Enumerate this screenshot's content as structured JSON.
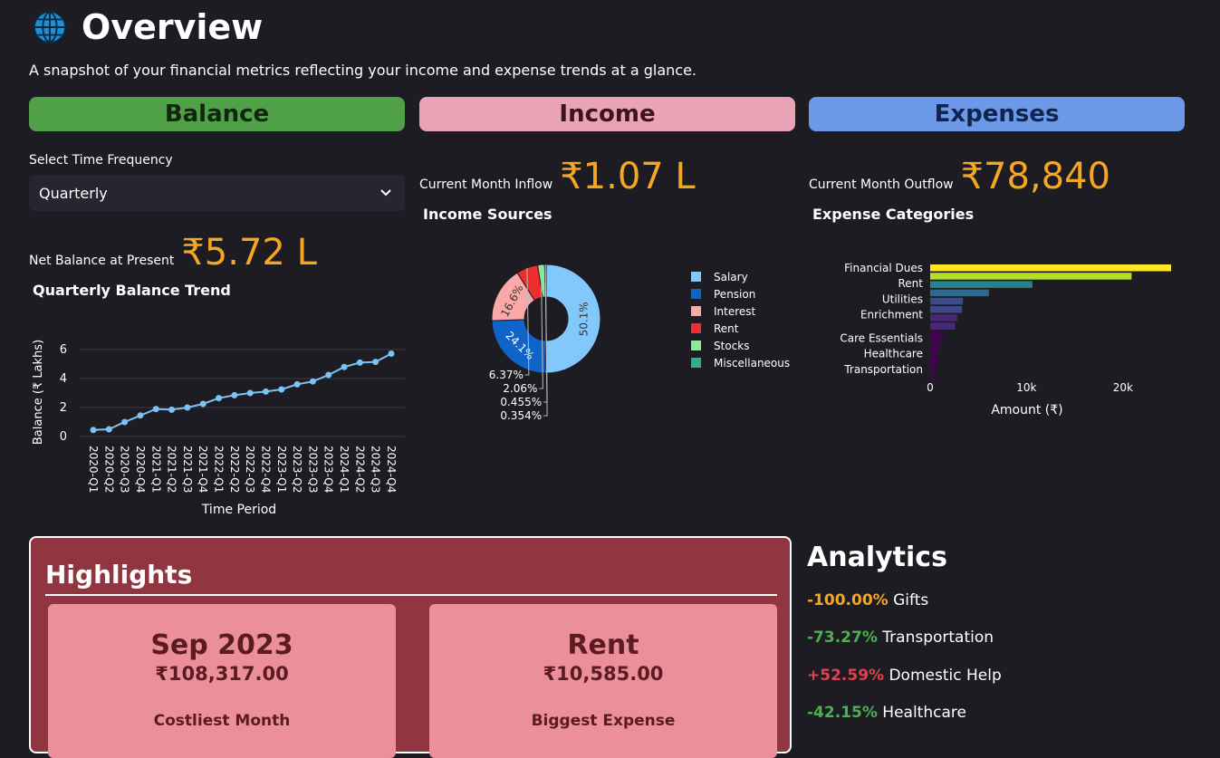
{
  "header": {
    "title": "Overview",
    "subtitle": "A snapshot of your financial metrics reflecting your income and expense trends at a glance.",
    "icon": "globe-icon"
  },
  "sections": {
    "balance": "Balance",
    "income": "Income",
    "expenses": "Expenses"
  },
  "colors": {
    "balance": "#4fa047",
    "income": "#e9a2b6",
    "expenses": "#6b99e8",
    "accent_value": "#f5a623",
    "highlights_bg": "#8f3640",
    "card_bg": "#eb9098",
    "positive": "#4caf50",
    "negative": "#e0414f"
  },
  "balance": {
    "frequency_label": "Select Time Frequency",
    "frequency_value": "Quarterly",
    "net_label": "Net Balance at Present",
    "net_value": "₹5.72 L",
    "chart_title": "Quarterly Balance Trend"
  },
  "income": {
    "inflow_label": "Current Month Inflow",
    "inflow_value": "₹1.07 L",
    "chart_title": "Income Sources"
  },
  "expenses": {
    "outflow_label": "Current Month Outflow",
    "outflow_value": "₹78,840",
    "chart_title": "Expense Categories"
  },
  "chart_data": [
    {
      "type": "line",
      "title": "Quarterly Balance Trend",
      "xlabel": "Time Period",
      "ylabel": "Balance (₹ Lakhs)",
      "x": [
        "2020-Q1",
        "2020-Q2",
        "2020-Q3",
        "2020-Q4",
        "2021-Q1",
        "2021-Q2",
        "2021-Q3",
        "2021-Q4",
        "2022-Q1",
        "2022-Q2",
        "2022-Q3",
        "2022-Q4",
        "2023-Q1",
        "2023-Q2",
        "2023-Q3",
        "2023-Q4",
        "2024-Q1",
        "2024-Q2",
        "2024-Q3",
        "2024-Q4"
      ],
      "y": [
        0.45,
        0.5,
        1.0,
        1.45,
        1.9,
        1.85,
        2.0,
        2.25,
        2.65,
        2.85,
        3.0,
        3.1,
        3.25,
        3.6,
        3.8,
        4.25,
        4.8,
        5.1,
        5.15,
        5.72
      ],
      "ylim": [
        -0.5,
        7
      ],
      "yticks": [
        0,
        2,
        4,
        6
      ],
      "color": "#7cc3f5",
      "grid": true
    },
    {
      "type": "pie",
      "title": "Income Sources",
      "labels": [
        "Salary",
        "Pension",
        "Interest",
        "Rent",
        "Stocks",
        "Miscellaneous"
      ],
      "values": [
        50.1,
        24.1,
        16.6,
        6.37,
        2.06,
        0.455
      ],
      "display_labels": [
        "50.1%",
        "24.1%",
        "16.6%",
        "6.37%",
        "2.06%",
        "0.455%"
      ],
      "extra_label": "0.354%",
      "colors": [
        "#82c8fb",
        "#0f64c8",
        "#fba8a8",
        "#ef2f2f",
        "#8de99b",
        "#2ab08f"
      ],
      "legend": "right"
    },
    {
      "type": "bar",
      "orientation": "horizontal",
      "title": "Expense Categories",
      "xlabel": "Amount (₹)",
      "tick_labels": [
        "Financial Dues",
        "Rent",
        "Utilities",
        "Enrichment",
        "Care Essentials",
        "Healthcare",
        "Transportation"
      ],
      "categories": [
        "Financial Dues",
        "",
        "Rent",
        "",
        "Utilities",
        "",
        "",
        "Enrichment",
        "",
        "Care Essentials",
        "",
        "Healthcare",
        "",
        "Transportation"
      ],
      "values": [
        25000,
        20900,
        10600,
        6100,
        3400,
        3300,
        2800,
        2600,
        1400,
        1100,
        900,
        800,
        700,
        450
      ],
      "colors": [
        "#fde725",
        "#b5de2b",
        "#26828e",
        "#31688e",
        "#3e4989",
        "#3e4989",
        "#482878",
        "#482878",
        "#440154",
        "#440154",
        "#440154",
        "#440154",
        "#440154",
        "#440154"
      ],
      "xlim": [
        0,
        25000
      ],
      "xticks": [
        "0",
        "10k",
        "20k"
      ],
      "grid": false
    }
  ],
  "highlights": {
    "title": "Highlights",
    "cards": [
      {
        "value": "Sep 2023",
        "amount": "₹108,317.00",
        "caption": "Costliest Month"
      },
      {
        "value": "Rent",
        "amount": "₹10,585.00",
        "caption": "Biggest Expense"
      }
    ]
  },
  "analytics": {
    "title": "Analytics",
    "items": [
      {
        "pct": "-100.00%",
        "label": "Gifts",
        "color": "#f5a623"
      },
      {
        "pct": "-73.27%",
        "label": "Transportation",
        "color": "#4caf50"
      },
      {
        "pct": "+52.59%",
        "label": "Domestic Help",
        "color": "#e0414f"
      },
      {
        "pct": "-42.15%",
        "label": "Healthcare",
        "color": "#4caf50"
      }
    ]
  }
}
